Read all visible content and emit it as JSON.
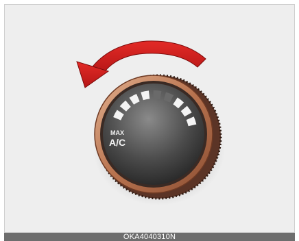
{
  "dial": {
    "label_line1": "MAX",
    "label_line2": "A/C",
    "rotation_direction": "counter-clockwise",
    "arrow_icon": "rotate-left-arrow-icon"
  },
  "caption": {
    "code": "OKA4040310N"
  },
  "colors": {
    "background": "#eeeeee",
    "arrow": "#d01a1a",
    "ring": "#c98a66",
    "knob_face": "#5a5a5a",
    "marks": "#ffffff",
    "caption_bar": "#6d6d6d"
  }
}
